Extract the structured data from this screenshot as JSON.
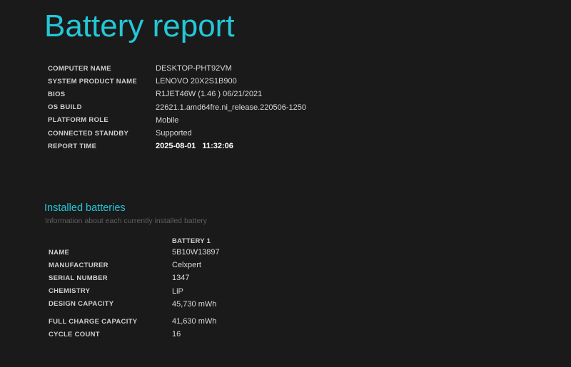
{
  "header": {
    "title": "Battery report"
  },
  "system_info": [
    {
      "label": "COMPUTER NAME",
      "value": "DESKTOP-PHT92VM"
    },
    {
      "label": "SYSTEM PRODUCT NAME",
      "value": "LENOVO 20X2S1B900"
    },
    {
      "label": "BIOS",
      "value": "R1JET46W (1.46 ) 06/21/2021"
    },
    {
      "label": "OS BUILD",
      "value": "22621.1.amd64fre.ni_release.220506-1250"
    },
    {
      "label": "PLATFORM ROLE",
      "value": "Mobile"
    },
    {
      "label": "CONNECTED STANDBY",
      "value": "Supported"
    },
    {
      "label": "REPORT TIME",
      "value": "2025-08-01   11:32:06"
    }
  ],
  "installed_batteries": {
    "title": "Installed batteries",
    "subtitle": "Information about each currently installed battery",
    "column_header": "BATTERY 1",
    "rows": [
      {
        "label": "NAME",
        "value": "5B10W13897"
      },
      {
        "label": "MANUFACTURER",
        "value": "Celxpert"
      },
      {
        "label": "SERIAL NUMBER",
        "value": "1347"
      },
      {
        "label": "CHEMISTRY",
        "value": "LiP"
      },
      {
        "label": "DESIGN CAPACITY",
        "value": "45,730 mWh"
      },
      {
        "label": "FULL CHARGE CAPACITY",
        "value": "41,630 mWh"
      },
      {
        "label": "CYCLE COUNT",
        "value": "16"
      }
    ]
  },
  "colors": {
    "background": "#1a1a1b",
    "accent": "#24c7d6",
    "label": "#cfcfcf",
    "value": "#d9d9d9",
    "subtitle": "#5f5f5f"
  }
}
